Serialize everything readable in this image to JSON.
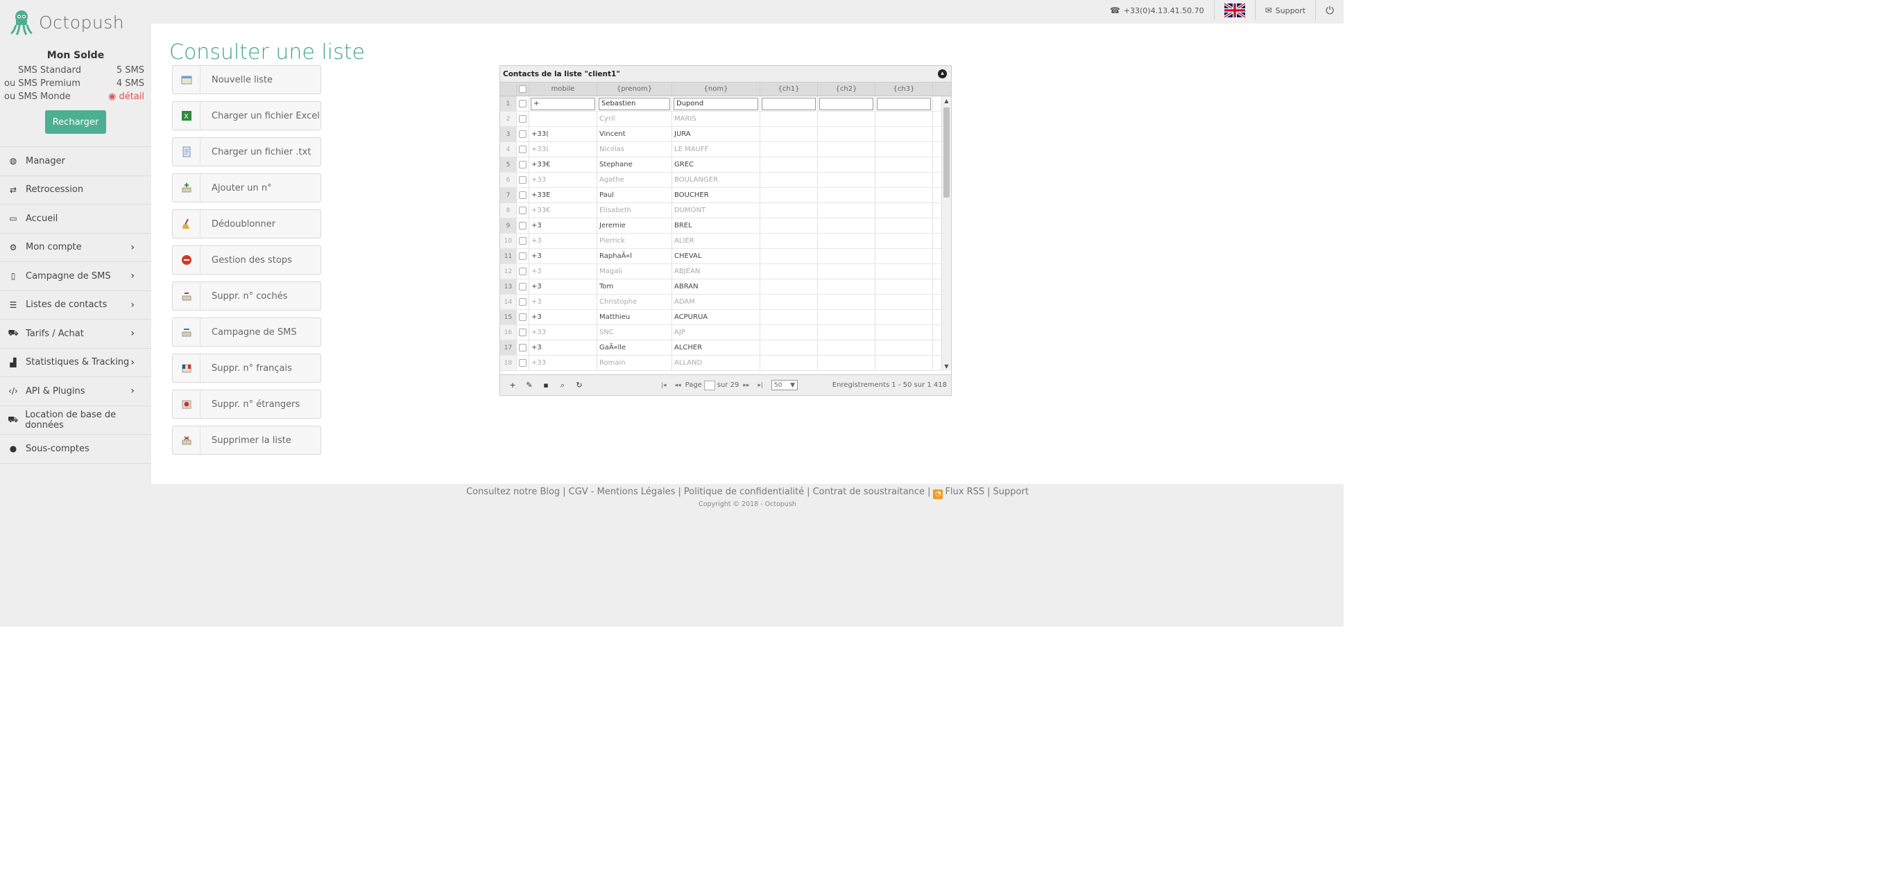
{
  "header": {
    "brand": "Octopush",
    "phone": "+33(0)4.13.41.50.70",
    "support": "Support",
    "language_flag_icon": "uk-flag-icon",
    "logout_icon": "power-icon"
  },
  "balance": {
    "title": "Mon Solde",
    "rows": [
      {
        "prefix": "",
        "label": "SMS Standard",
        "value": "5 SMS"
      },
      {
        "prefix": "ou",
        "label": "SMS Premium",
        "value": "4 SMS"
      },
      {
        "prefix": "ou",
        "label": "SMS Monde",
        "value": "détail"
      }
    ],
    "recharge": "Recharger"
  },
  "nav": [
    {
      "label": "Manager",
      "icon": "dashboard-icon"
    },
    {
      "label": "Retrocession",
      "icon": "exchange-icon"
    },
    {
      "label": "Accueil",
      "icon": "desktop-icon"
    },
    {
      "label": "Mon compte",
      "icon": "gear-icon"
    },
    {
      "label": "Campagne de SMS",
      "icon": "mobile-icon"
    },
    {
      "label": "Listes de contacts",
      "icon": "list-icon"
    },
    {
      "label": "Tarifs / Achat",
      "icon": "cart-icon"
    },
    {
      "label": "Statistiques & Tracking",
      "icon": "bar-chart-icon"
    },
    {
      "label": "API & Plugins",
      "icon": "code-icon"
    },
    {
      "label": "Location de base de données",
      "icon": "cart-icon"
    },
    {
      "label": "Sous-comptes",
      "icon": "user-icon"
    }
  ],
  "page": {
    "title": "Consulter une liste"
  },
  "actions": [
    {
      "label": "Nouvelle liste"
    },
    {
      "label": "Charger un fichier Excel"
    },
    {
      "label": "Charger un fichier .txt"
    },
    {
      "label": "Ajouter un n°"
    },
    {
      "label": "Dédoublonner"
    },
    {
      "label": "Gestion des stops"
    },
    {
      "label": "Suppr. n° cochés"
    },
    {
      "label": "Campagne de SMS"
    },
    {
      "label": "Suppr. n° français"
    },
    {
      "label": "Suppr. n° étrangers"
    },
    {
      "label": "Supprimer la liste"
    }
  ],
  "grid": {
    "caption": "Contacts de la liste \"client1\"",
    "columns": [
      "mobile",
      "{prenom}",
      "{nom}",
      "{ch1}",
      "{ch2}",
      "{ch3}"
    ],
    "filter": {
      "rownum": "1",
      "mobile": "+",
      "prenom": "Sebastien",
      "nom": "Dupond"
    },
    "rows": [
      {
        "n": "2",
        "mobile": "",
        "prenom": "Cyril",
        "nom": "MARIS"
      },
      {
        "n": "3",
        "mobile": "+33(",
        "prenom": "Vincent",
        "nom": "JURA"
      },
      {
        "n": "4",
        "mobile": "+33(",
        "prenom": "Nicolas",
        "nom": "LE MAUFF"
      },
      {
        "n": "5",
        "mobile": "+33€",
        "prenom": "Stephane",
        "nom": "GREC"
      },
      {
        "n": "6",
        "mobile": "+33",
        "prenom": "Agathe",
        "nom": "BOULANGER"
      },
      {
        "n": "7",
        "mobile": "+33E",
        "prenom": "Paul",
        "nom": "BOUCHER"
      },
      {
        "n": "8",
        "mobile": "+33€",
        "prenom": "Elisabeth",
        "nom": "DUMONT"
      },
      {
        "n": "9",
        "mobile": "+3",
        "prenom": "Jeremie",
        "nom": "BREL"
      },
      {
        "n": "10",
        "mobile": "+3",
        "prenom": "Pierrick",
        "nom": "ALIER"
      },
      {
        "n": "11",
        "mobile": "+3",
        "prenom": "RaphaÃ«l",
        "nom": "CHEVAL"
      },
      {
        "n": "12",
        "mobile": "+3",
        "prenom": "Magali",
        "nom": "ABJEAN"
      },
      {
        "n": "13",
        "mobile": "+3",
        "prenom": "Tom",
        "nom": "ABRAN"
      },
      {
        "n": "14",
        "mobile": "+3",
        "prenom": "Christophe",
        "nom": "ADAM"
      },
      {
        "n": "15",
        "mobile": "+3",
        "prenom": "Matthieu",
        "nom": "ACPURUA"
      },
      {
        "n": "16",
        "mobile": "+33",
        "prenom": "SNC",
        "nom": "AJP"
      },
      {
        "n": "17",
        "mobile": "+3",
        "prenom": "GaÃ«lle",
        "nom": "ALCHER"
      },
      {
        "n": "18",
        "mobile": "+33",
        "prenom": "Romain",
        "nom": "ALLAND"
      }
    ],
    "pager": {
      "page_label": "Page",
      "of_label": "sur 29",
      "per_page": "50",
      "records": "Enregistrements 1 - 50 sur 1 418"
    }
  },
  "footer": {
    "links": [
      "Consultez notre Blog",
      "CGV - Mentions Légales",
      "Politique de confidentialité",
      "Contrat de soustraitance",
      "Flux RSS",
      "Support"
    ],
    "copyright": "Copyright © 2018 - Octopush"
  },
  "colors": {
    "accent": "#4caf93",
    "title": "#45a38c",
    "danger": "#e05050",
    "rss": "#f39a21"
  }
}
